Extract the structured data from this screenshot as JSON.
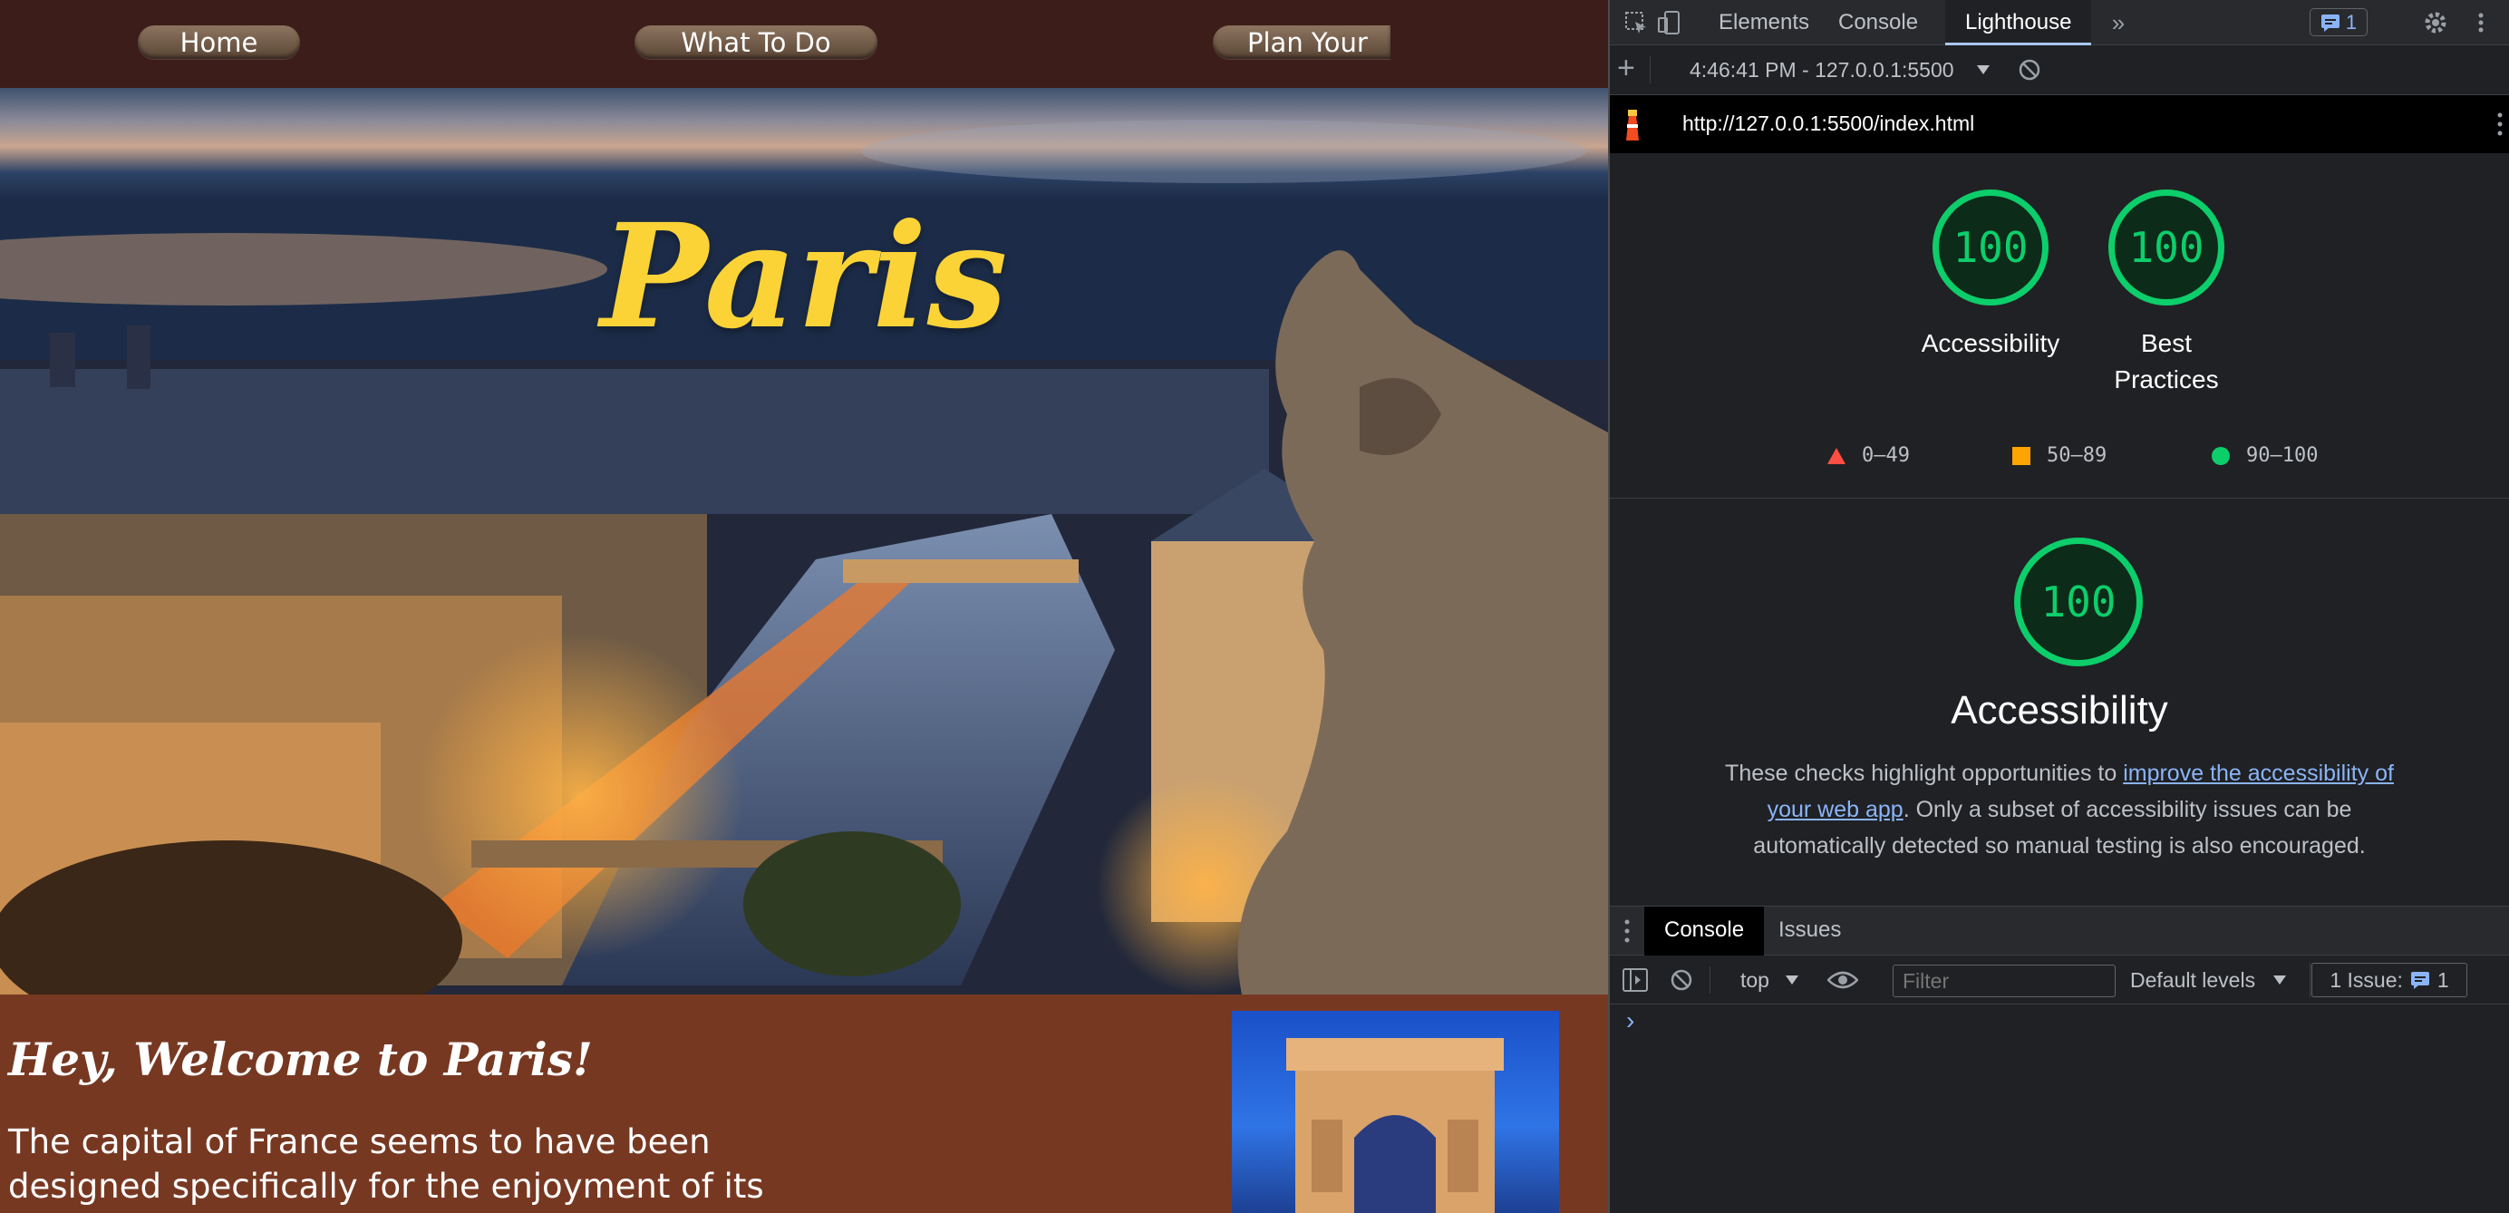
{
  "site": {
    "nav": [
      "Home",
      "What To Do",
      "Plan Your"
    ],
    "hero_title": "Paris",
    "welcome_heading": "Hey, Welcome to Paris!",
    "welcome_text": "The capital of France seems to have been designed specifically for the enjoyment of its"
  },
  "devtools": {
    "tabs": [
      "Elements",
      "Console",
      "Lighthouse"
    ],
    "active_tab": "Lighthouse",
    "more_tabs": "»",
    "issues_count": "1",
    "toolbar2": {
      "add": "+",
      "timestamp": "4:46:41 PM - 127.0.0.1:5500"
    },
    "url": "http://127.0.0.1:5500/index.html",
    "scores": [
      {
        "value": "100",
        "label": "Accessibility"
      },
      {
        "value": "100",
        "label": "Best Practices"
      }
    ],
    "legend": [
      {
        "label": "0–49",
        "color": "#ff4e42",
        "shape": "triangle"
      },
      {
        "label": "50–89",
        "color": "#ffa400",
        "shape": "square"
      },
      {
        "label": "90–100",
        "color": "#0cce6b",
        "shape": "circle"
      }
    ],
    "category": {
      "score": "100",
      "title": "Accessibility",
      "desc_before": "These checks highlight opportunities to ",
      "desc_link": "improve the accessibility of your web app",
      "desc_after": ". Only a subset of accessibility issues can be automatically detected so manual testing is also encouraged."
    },
    "drawer": {
      "tabs": [
        "Console",
        "Issues"
      ],
      "active": "Console",
      "context": "top",
      "filter_placeholder": "Filter",
      "levels": "Default levels",
      "issues_label": "1 Issue:",
      "issues_count": "1",
      "prompt": "›"
    }
  },
  "colors": {
    "pass_green": "#0cce6b",
    "link": "#8ab4f8",
    "hero_title": "#fbd337",
    "nav_bg": "#3c1d19",
    "site_bg": "#773822"
  }
}
